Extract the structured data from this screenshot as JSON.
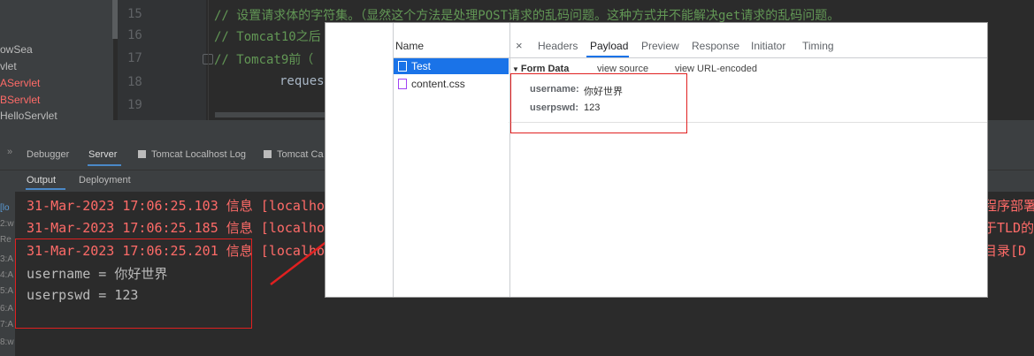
{
  "project": {
    "items": [
      {
        "label": "owSea",
        "color": "#bbbbbb"
      },
      {
        "label": "vlet",
        "color": "#bbbbbb"
      },
      {
        "label": "AServlet",
        "color": "#ff6b68"
      },
      {
        "label": "BServlet",
        "color": "#ff6b68"
      },
      {
        "label": "HelloServlet",
        "color": "#bbbbbb"
      }
    ]
  },
  "editor": {
    "line_numbers": [
      "15",
      "16",
      "17",
      "18",
      "19"
    ],
    "code": [
      "// 设置请求体的字符集。（显然这个方法是处理POST请求的乱码问题。这种方式并不能解决get请求的乱码问题。",
      "// Tomcat10之后",
      "// Tomcat9前（",
      "reques"
    ]
  },
  "tool_window": {
    "collapse_glyph": "»",
    "tabs": {
      "debugger": "Debugger",
      "server": "Server",
      "localhost_log": "Tomcat Localhost Log",
      "catalina_log": "Tomcat Ca"
    },
    "subtabs": {
      "output": "Output",
      "deployment": "Deployment"
    },
    "left_column": [
      "[lo",
      "2:w",
      "Re",
      "3:A",
      "4:A",
      "5:A",
      "6:A",
      "7:A",
      "8:w"
    ]
  },
  "console": {
    "log_lines": [
      "31-Mar-2023 17:06:25.103 信息 [localho",
      "31-Mar-2023 17:06:25.185 信息 [localho",
      "31-Mar-2023 17:06:25.201 信息 [localho"
    ],
    "log_tails": [
      "程序部署",
      "于TLD的",
      "目录[D"
    ],
    "output_lines": [
      "username = 你好世界",
      "userpswd = 123"
    ]
  },
  "devtools": {
    "name_header": "Name",
    "requests": [
      {
        "name": "Test",
        "icon": "document-icon",
        "selected": true
      },
      {
        "name": "content.css",
        "icon": "css-file-icon",
        "selected": false
      }
    ],
    "close_glyph": "×",
    "tabs": [
      "Headers",
      "Payload",
      "Preview",
      "Response",
      "Initiator",
      "Timing"
    ],
    "active_tab": "Payload",
    "form_data": {
      "title": "Form Data",
      "view_source": "view source",
      "view_url_encoded": "view URL-encoded",
      "fields": [
        {
          "key": "username:",
          "value": "你好世界"
        },
        {
          "key": "userpswd:",
          "value": "123"
        }
      ]
    }
  },
  "colors": {
    "highlight_red": "#e02020",
    "log_red": "#ff6b68",
    "selection_blue": "#1a73e8",
    "comment_green": "#629755"
  }
}
